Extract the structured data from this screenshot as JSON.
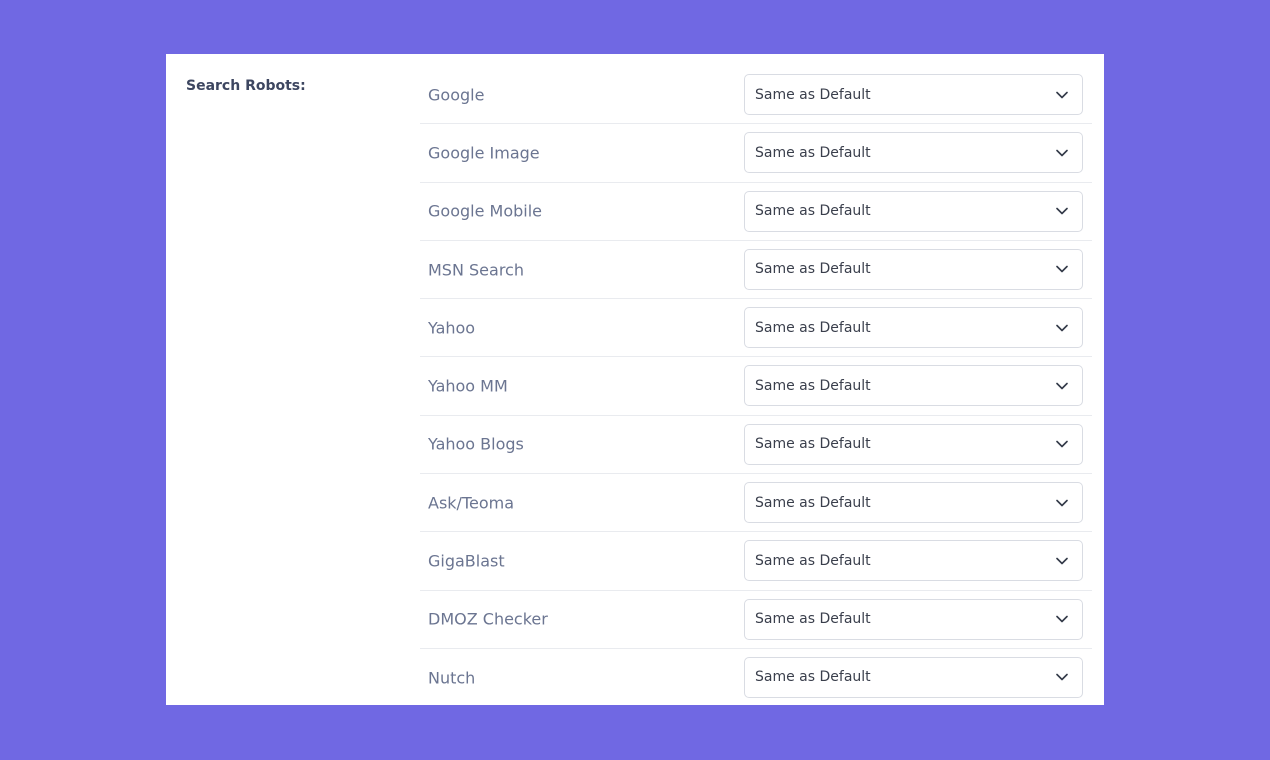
{
  "section": {
    "label": "Search Robots:"
  },
  "robots": [
    {
      "name": "Google",
      "value": "Same as Default"
    },
    {
      "name": "Google Image",
      "value": "Same as Default"
    },
    {
      "name": "Google Mobile",
      "value": "Same as Default"
    },
    {
      "name": "MSN Search",
      "value": "Same as Default"
    },
    {
      "name": "Yahoo",
      "value": "Same as Default"
    },
    {
      "name": "Yahoo MM",
      "value": "Same as Default"
    },
    {
      "name": "Yahoo Blogs",
      "value": "Same as Default"
    },
    {
      "name": "Ask/Teoma",
      "value": "Same as Default"
    },
    {
      "name": "GigaBlast",
      "value": "Same as Default"
    },
    {
      "name": "DMOZ Checker",
      "value": "Same as Default"
    },
    {
      "name": "Nutch",
      "value": "Same as Default"
    }
  ],
  "icons": {
    "select_arrow": "chevron-down-icon"
  },
  "colors": {
    "background": "#7068e3",
    "card": "#ffffff",
    "label": "#3d4660",
    "robot_name": "#6b7591"
  }
}
